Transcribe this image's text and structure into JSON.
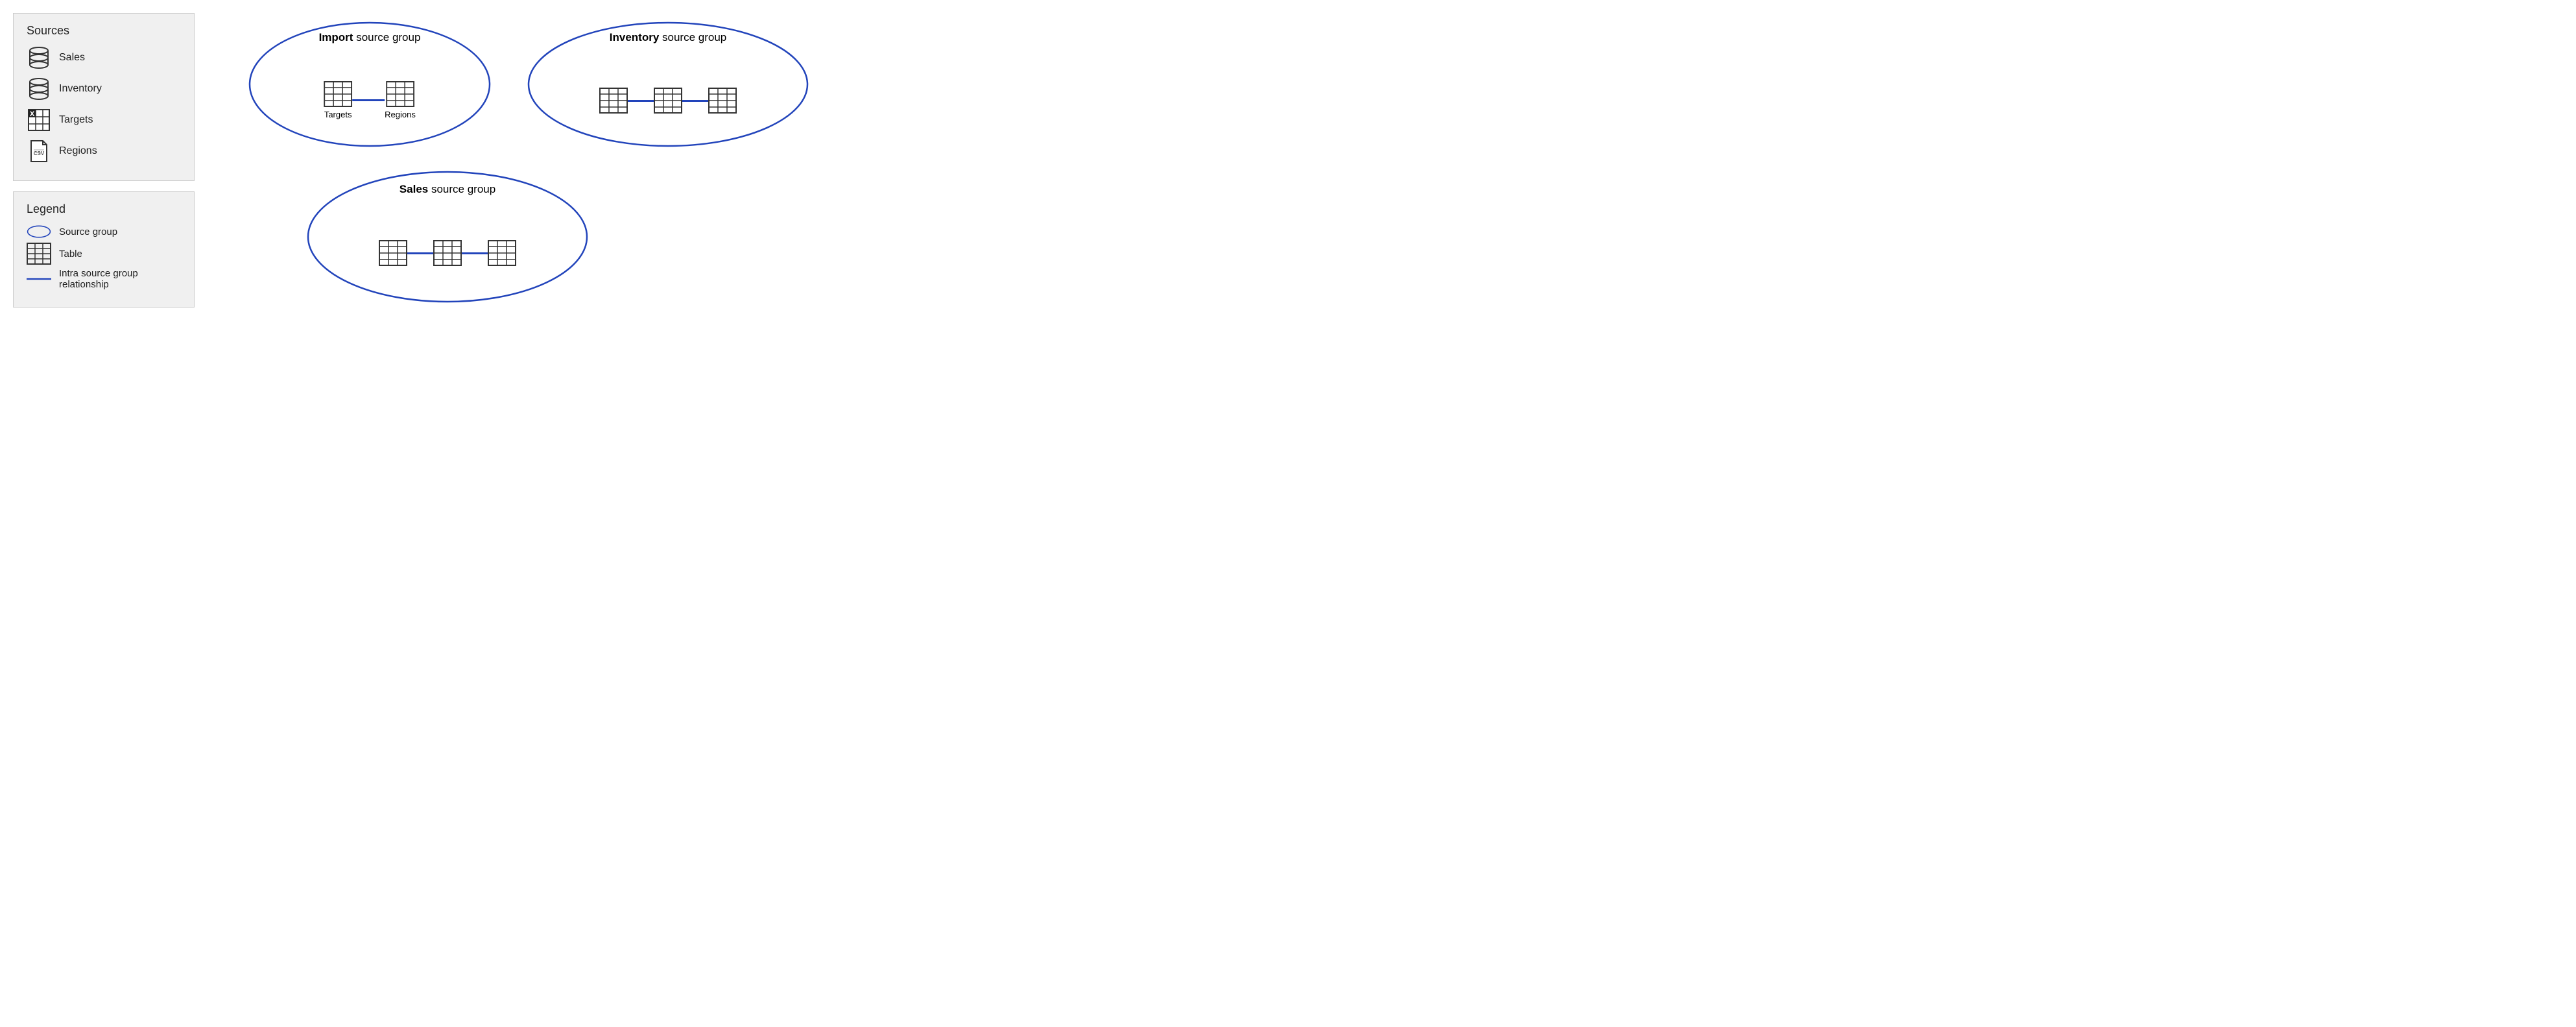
{
  "left": {
    "sources_title": "Sources",
    "sources": [
      {
        "id": "sales",
        "label": "Sales",
        "icon_type": "database"
      },
      {
        "id": "inventory",
        "label": "Inventory",
        "icon_type": "database"
      },
      {
        "id": "targets",
        "label": "Targets",
        "icon_type": "excel"
      },
      {
        "id": "regions",
        "label": "Regions",
        "icon_type": "csv"
      }
    ],
    "legend_title": "Legend",
    "legend": [
      {
        "id": "source-group-legend",
        "label": "Source group",
        "icon_type": "ellipse"
      },
      {
        "id": "table-legend",
        "label": "Table",
        "icon_type": "table"
      },
      {
        "id": "relationship-legend",
        "label": "Intra source group relationship",
        "icon_type": "line"
      }
    ]
  },
  "diagram": {
    "groups": [
      {
        "id": "import-group",
        "title_bold": "Import",
        "title_rest": " source group",
        "tables": [
          "Targets",
          "Regions"
        ],
        "connectors": 1
      },
      {
        "id": "inventory-group",
        "title_bold": "Inventory",
        "title_rest": " source group",
        "tables": [
          "",
          "",
          ""
        ],
        "connectors": 2
      },
      {
        "id": "sales-group",
        "title_bold": "Sales",
        "title_rest": " source group",
        "tables": [
          "",
          "",
          ""
        ],
        "connectors": 2
      }
    ]
  },
  "colors": {
    "blue": "#2244bb",
    "border": "#cccccc",
    "bg": "#f0f0f0",
    "text": "#222222"
  }
}
